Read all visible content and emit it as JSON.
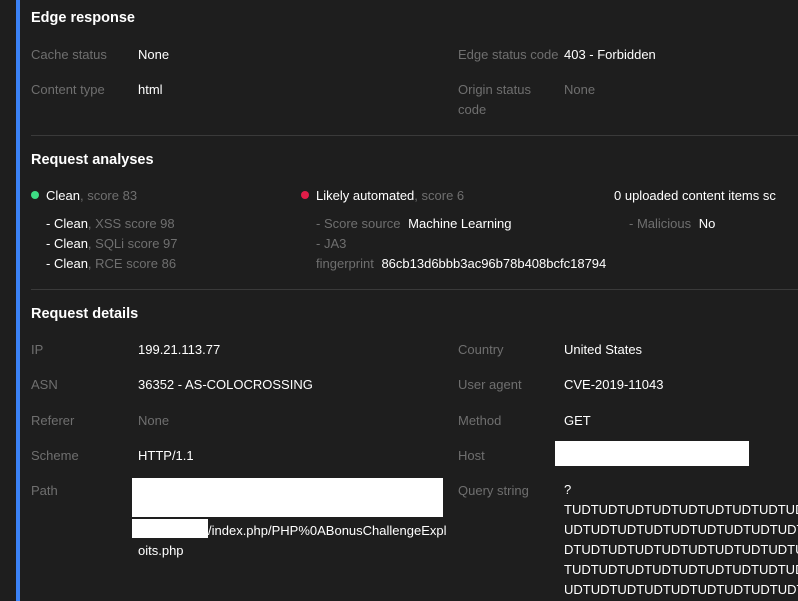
{
  "edge_response": {
    "title": "Edge response",
    "cache_status_label": "Cache status",
    "cache_status_value": "None",
    "content_type_label": "Content type",
    "content_type_value": "html",
    "edge_status_label": "Edge status code",
    "edge_status_value": "403 - Forbidden",
    "origin_status_label_1": "Origin status",
    "origin_status_label_2": "code",
    "origin_status_value": "None"
  },
  "request_analyses": {
    "title": "Request analyses",
    "clean": {
      "label": "Clean",
      "score": ", score 83",
      "color": "#3ddc84"
    },
    "clean_items": [
      {
        "prefix": "- ",
        "label": "Clean",
        "detail": ", XSS score 98"
      },
      {
        "prefix": "- ",
        "label": "Clean",
        "detail": ", SQLi score 97"
      },
      {
        "prefix": "- ",
        "label": "Clean",
        "detail": ", RCE score 86"
      }
    ],
    "automated": {
      "label": "Likely automated",
      "score": ", score 6",
      "color": "#e11d48"
    },
    "score_source_prefix": "- Score source",
    "score_source_value": "Machine Learning",
    "ja3_prefix": "- JA3",
    "fingerprint_label": "fingerprint",
    "fingerprint_value": "86cb13d6bbb3ac96b78b408bcfc18794",
    "uploaded": "0 uploaded content items sc",
    "malicious_label": "- Malicious",
    "malicious_value": "No"
  },
  "request_details": {
    "title": "Request details",
    "ip_label": "IP",
    "ip_value": "199.21.113.77",
    "asn_label": "ASN",
    "asn_value": "36352 - AS-COLOCROSSING",
    "referer_label": "Referer",
    "referer_value": "None",
    "scheme_label": "Scheme",
    "scheme_value": "HTTP/1.1",
    "path_label": "Path",
    "path_value_line2": "/index.php/PHP%0ABonusChallengeExpl",
    "path_value_line3": "oits.php",
    "country_label": "Country",
    "country_value": "United States",
    "user_agent_label": "User agent",
    "user_agent_value": "CVE-2019-11043",
    "method_label": "Method",
    "method_value": "GET",
    "host_label": "Host",
    "query_label": "Query string",
    "query_lines": [
      "?",
      "TUDTUDTUDTUDTUDTUDTUDTUDTUDTU",
      "UDTUDTUDTUDTUDTUDTUDTUDTUDTUD",
      "DTUDTUDTUDTUDTUDTUDTUDTUDTUDT",
      "TUDTUDTUDTUDTUDTUDTUDTUDTUDTU",
      "UDTUDTUDTUDTUDTUDTUDTUDTUDTUD"
    ]
  }
}
